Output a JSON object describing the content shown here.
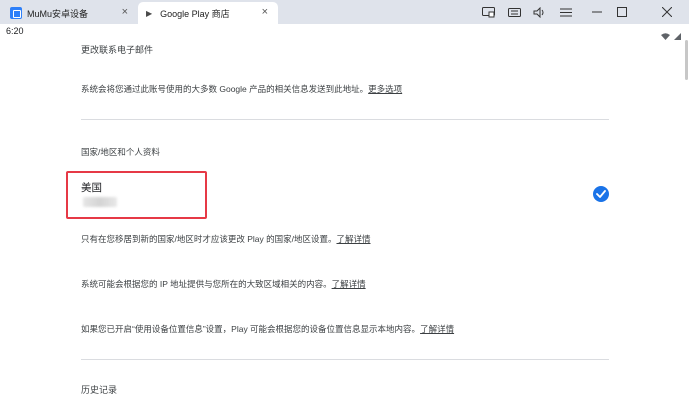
{
  "window": {
    "app_tab_label": "MuMu安卓设备",
    "active_tab_label": "Google Play 商店",
    "close_glyph": "×"
  },
  "status_bar": {
    "time": "6:20"
  },
  "content": {
    "contact_heading": "更改联系电子邮件",
    "contact_desc": "系统会将您通过此账号使用的大多数 Google 产品的相关信息发送到此地址。",
    "more_options": "更多选项",
    "country_heading": "国家/地区和个人资料",
    "country_name": "美国",
    "note1": "只有在您移居到新的国家/地区时才应该更改 Play 的国家/地区设置。",
    "note2": "系统可能会根据您的 IP 地址提供与您所在的大致区域相关的内容。",
    "note3": "如果您已开启“使用设备位置信息”设置，Play 可能会根据您的设备位置信息显示本地内容。",
    "learn_more": "了解详情",
    "history_heading": "历史记录"
  },
  "colors": {
    "accent": "#1a73e8",
    "highlight_border": "#e63946",
    "titlebar": "#dfe3eb"
  },
  "icons": [
    "app-logo-icon",
    "play-icon",
    "screenshot-icon",
    "keyboard-icon",
    "volume-icon",
    "menu-icon",
    "minimize-icon",
    "maximize-icon",
    "close-icon",
    "wifi-icon",
    "signal-icon",
    "check-circle-icon"
  ]
}
